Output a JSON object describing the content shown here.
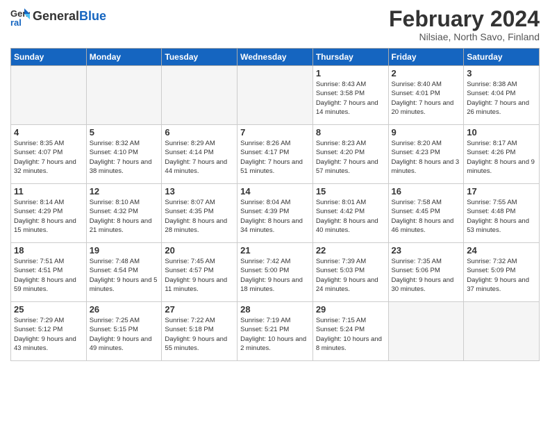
{
  "header": {
    "logo_general": "General",
    "logo_blue": "Blue",
    "month_title": "February 2024",
    "location": "Nilsiae, North Savo, Finland"
  },
  "days_of_week": [
    "Sunday",
    "Monday",
    "Tuesday",
    "Wednesday",
    "Thursday",
    "Friday",
    "Saturday"
  ],
  "weeks": [
    [
      {
        "day": "",
        "info": ""
      },
      {
        "day": "",
        "info": ""
      },
      {
        "day": "",
        "info": ""
      },
      {
        "day": "",
        "info": ""
      },
      {
        "day": "1",
        "info": "Sunrise: 8:43 AM\nSunset: 3:58 PM\nDaylight: 7 hours\nand 14 minutes."
      },
      {
        "day": "2",
        "info": "Sunrise: 8:40 AM\nSunset: 4:01 PM\nDaylight: 7 hours\nand 20 minutes."
      },
      {
        "day": "3",
        "info": "Sunrise: 8:38 AM\nSunset: 4:04 PM\nDaylight: 7 hours\nand 26 minutes."
      }
    ],
    [
      {
        "day": "4",
        "info": "Sunrise: 8:35 AM\nSunset: 4:07 PM\nDaylight: 7 hours\nand 32 minutes."
      },
      {
        "day": "5",
        "info": "Sunrise: 8:32 AM\nSunset: 4:10 PM\nDaylight: 7 hours\nand 38 minutes."
      },
      {
        "day": "6",
        "info": "Sunrise: 8:29 AM\nSunset: 4:14 PM\nDaylight: 7 hours\nand 44 minutes."
      },
      {
        "day": "7",
        "info": "Sunrise: 8:26 AM\nSunset: 4:17 PM\nDaylight: 7 hours\nand 51 minutes."
      },
      {
        "day": "8",
        "info": "Sunrise: 8:23 AM\nSunset: 4:20 PM\nDaylight: 7 hours\nand 57 minutes."
      },
      {
        "day": "9",
        "info": "Sunrise: 8:20 AM\nSunset: 4:23 PM\nDaylight: 8 hours\nand 3 minutes."
      },
      {
        "day": "10",
        "info": "Sunrise: 8:17 AM\nSunset: 4:26 PM\nDaylight: 8 hours\nand 9 minutes."
      }
    ],
    [
      {
        "day": "11",
        "info": "Sunrise: 8:14 AM\nSunset: 4:29 PM\nDaylight: 8 hours\nand 15 minutes."
      },
      {
        "day": "12",
        "info": "Sunrise: 8:10 AM\nSunset: 4:32 PM\nDaylight: 8 hours\nand 21 minutes."
      },
      {
        "day": "13",
        "info": "Sunrise: 8:07 AM\nSunset: 4:35 PM\nDaylight: 8 hours\nand 28 minutes."
      },
      {
        "day": "14",
        "info": "Sunrise: 8:04 AM\nSunset: 4:39 PM\nDaylight: 8 hours\nand 34 minutes."
      },
      {
        "day": "15",
        "info": "Sunrise: 8:01 AM\nSunset: 4:42 PM\nDaylight: 8 hours\nand 40 minutes."
      },
      {
        "day": "16",
        "info": "Sunrise: 7:58 AM\nSunset: 4:45 PM\nDaylight: 8 hours\nand 46 minutes."
      },
      {
        "day": "17",
        "info": "Sunrise: 7:55 AM\nSunset: 4:48 PM\nDaylight: 8 hours\nand 53 minutes."
      }
    ],
    [
      {
        "day": "18",
        "info": "Sunrise: 7:51 AM\nSunset: 4:51 PM\nDaylight: 8 hours\nand 59 minutes."
      },
      {
        "day": "19",
        "info": "Sunrise: 7:48 AM\nSunset: 4:54 PM\nDaylight: 9 hours\nand 5 minutes."
      },
      {
        "day": "20",
        "info": "Sunrise: 7:45 AM\nSunset: 4:57 PM\nDaylight: 9 hours\nand 11 minutes."
      },
      {
        "day": "21",
        "info": "Sunrise: 7:42 AM\nSunset: 5:00 PM\nDaylight: 9 hours\nand 18 minutes."
      },
      {
        "day": "22",
        "info": "Sunrise: 7:39 AM\nSunset: 5:03 PM\nDaylight: 9 hours\nand 24 minutes."
      },
      {
        "day": "23",
        "info": "Sunrise: 7:35 AM\nSunset: 5:06 PM\nDaylight: 9 hours\nand 30 minutes."
      },
      {
        "day": "24",
        "info": "Sunrise: 7:32 AM\nSunset: 5:09 PM\nDaylight: 9 hours\nand 37 minutes."
      }
    ],
    [
      {
        "day": "25",
        "info": "Sunrise: 7:29 AM\nSunset: 5:12 PM\nDaylight: 9 hours\nand 43 minutes."
      },
      {
        "day": "26",
        "info": "Sunrise: 7:25 AM\nSunset: 5:15 PM\nDaylight: 9 hours\nand 49 minutes."
      },
      {
        "day": "27",
        "info": "Sunrise: 7:22 AM\nSunset: 5:18 PM\nDaylight: 9 hours\nand 55 minutes."
      },
      {
        "day": "28",
        "info": "Sunrise: 7:19 AM\nSunset: 5:21 PM\nDaylight: 10 hours\nand 2 minutes."
      },
      {
        "day": "29",
        "info": "Sunrise: 7:15 AM\nSunset: 5:24 PM\nDaylight: 10 hours\nand 8 minutes."
      },
      {
        "day": "",
        "info": ""
      },
      {
        "day": "",
        "info": ""
      }
    ]
  ]
}
